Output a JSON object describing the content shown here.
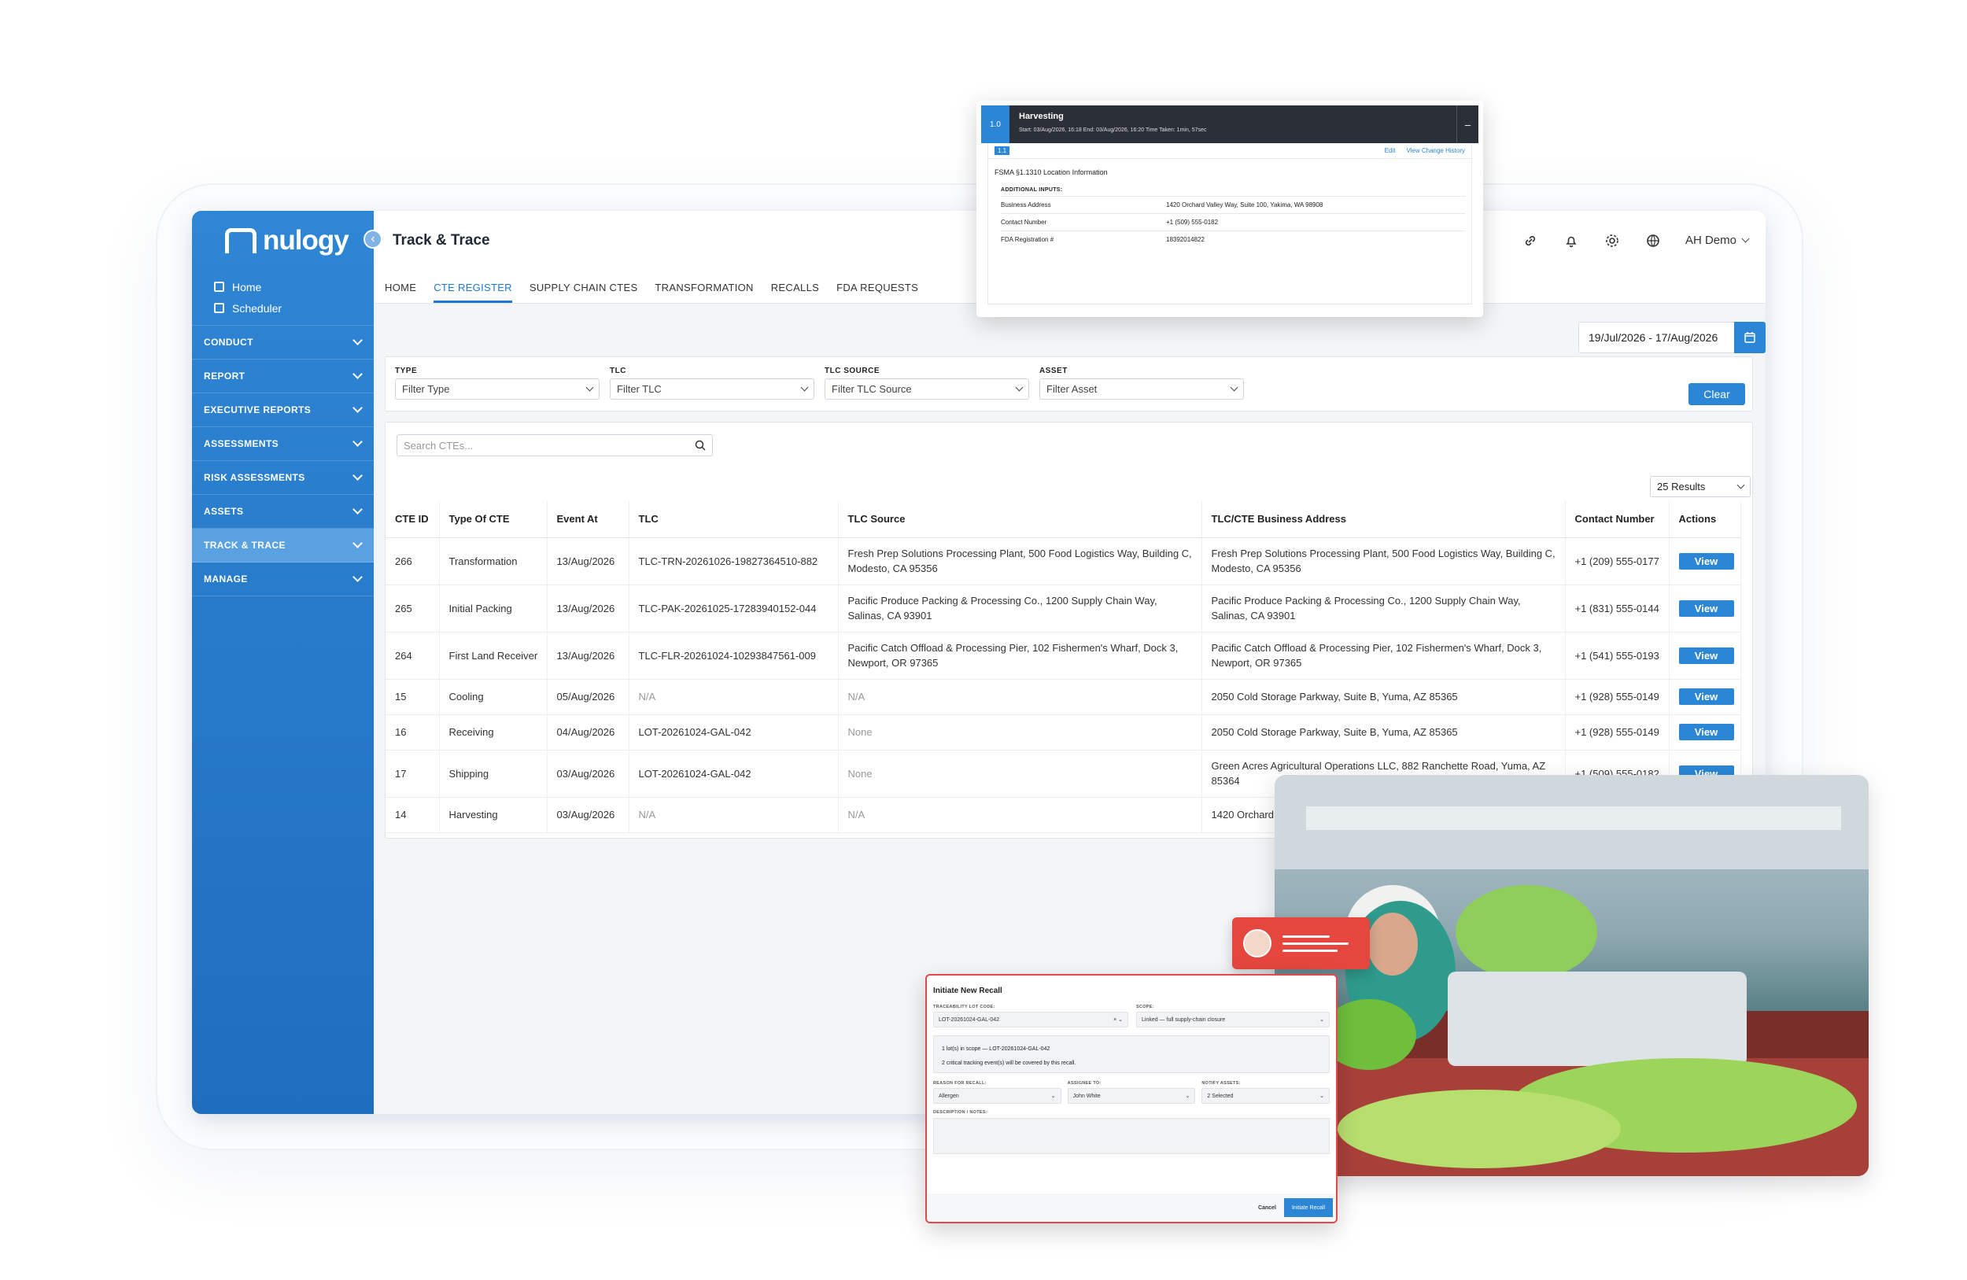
{
  "app": {
    "brand": "nulogy",
    "page_title": "Track & Trace",
    "user": "AH Demo",
    "date_range": "19/Jul/2026 - 17/Aug/2026",
    "clear_label": "Clear",
    "search_placeholder": "Search CTEs...",
    "results_label": "25 Results",
    "view_label": "View"
  },
  "sidebar": {
    "links": [
      {
        "label": "Home",
        "icon": "home-icon"
      },
      {
        "label": "Scheduler",
        "icon": "calendar-icon"
      }
    ],
    "sections": [
      {
        "label": "CONDUCT"
      },
      {
        "label": "REPORT"
      },
      {
        "label": "EXECUTIVE REPORTS"
      },
      {
        "label": "ASSESSMENTS"
      },
      {
        "label": "RISK ASSESSMENTS"
      },
      {
        "label": "ASSETS"
      },
      {
        "label": "TRACK & TRACE"
      },
      {
        "label": "MANAGE"
      }
    ]
  },
  "tabs": [
    "HOME",
    "CTE REGISTER",
    "SUPPLY CHAIN CTES",
    "TRANSFORMATION",
    "RECALLS",
    "FDA REQUESTS"
  ],
  "filters": [
    {
      "label": "TYPE",
      "placeholder": "Filter Type"
    },
    {
      "label": "TLC",
      "placeholder": "Filter TLC"
    },
    {
      "label": "TLC SOURCE",
      "placeholder": "Filter TLC Source"
    },
    {
      "label": "ASSET",
      "placeholder": "Filter Asset"
    }
  ],
  "table": {
    "headers": [
      "CTE ID",
      "Type Of CTE",
      "Event At",
      "TLC",
      "TLC Source",
      "TLC/CTE Business Address",
      "Contact Number",
      "Actions"
    ],
    "rows": [
      [
        "266",
        "Transformation",
        "13/Aug/2026",
        "TLC-TRN-20261026-19827364510-882",
        "Fresh Prep Solutions Processing Plant, 500 Food Logistics Way, Building C, Modesto, CA 95356",
        "Fresh Prep Solutions Processing Plant, 500 Food Logistics Way, Building C, Modesto, CA 95356",
        "+1 (209) 555-0177"
      ],
      [
        "265",
        "Initial Packing",
        "13/Aug/2026",
        "TLC-PAK-20261025-17283940152-044",
        "Pacific Produce Packing & Processing Co., 1200 Supply Chain Way, Salinas, CA 93901",
        "Pacific Produce Packing & Processing Co., 1200 Supply Chain Way, Salinas, CA 93901",
        "+1 (831) 555-0144"
      ],
      [
        "264",
        "First Land Receiver",
        "13/Aug/2026",
        "TLC-FLR-20261024-10293847561-009",
        "Pacific Catch Offload & Processing Pier, 102 Fishermen's Wharf, Dock 3, Newport, OR 97365",
        "Pacific Catch Offload & Processing Pier, 102 Fishermen's Wharf, Dock 3, Newport, OR 97365",
        "+1 (541) 555-0193"
      ],
      [
        "15",
        "Cooling",
        "05/Aug/2026",
        "N/A",
        "N/A",
        "2050 Cold Storage Parkway, Suite B, Yuma, AZ 85365",
        "+1 (928) 555-0149"
      ],
      [
        "16",
        "Receiving",
        "04/Aug/2026",
        "LOT-20261024-GAL-042",
        "None",
        "2050 Cold Storage Parkway, Suite B, Yuma, AZ 85365",
        "+1 (928) 555-0149"
      ],
      [
        "17",
        "Shipping",
        "03/Aug/2026",
        "LOT-20261024-GAL-042",
        "None",
        "Green Acres Agricultural Operations LLC, 882 Ranchette Road, Yuma, AZ 85364",
        "+1 (509) 555-0182"
      ],
      [
        "14",
        "Harvesting",
        "03/Aug/2026",
        "N/A",
        "N/A",
        "1420 Orchard",
        ""
      ]
    ]
  },
  "harvest_popup": {
    "step": "1.0",
    "title": "Harvesting",
    "subtitle": "Start: 03/Aug/2026, 16:18   End: 03/Aug/2026, 16:20   Time Taken: 1min, 57sec",
    "minimize": "–",
    "sub_step": "1.1",
    "edit_label": "Edit",
    "history_label": "View Change History",
    "heading": "FSMA §1.1310 Location Information",
    "additional_label": "ADDITIONAL INPUTS:",
    "fields": [
      {
        "label": "Business Address",
        "value": "1420 Orchard Valley Way, Suite 100, Yakima, WA 98908"
      },
      {
        "label": "Contact Number",
        "value": "+1 (509) 555-0182"
      },
      {
        "label": "FDA Registration #",
        "value": "18392014822"
      }
    ]
  },
  "recall_popup": {
    "title": "Initiate New Recall",
    "lot_label": "TRACEABILITY LOT CODE:",
    "lot_value": "LOT-20261024-GAL-042",
    "scope_label": "SCOPE:",
    "scope_value": "Linked — full supply-chain closure",
    "info_line1": "1 lot(s) in scope — LOT-20261024-GAL-042",
    "info_line2": "2 critical tracking event(s) will be covered by this recall.",
    "reason_label": "REASON FOR RECALL:",
    "reason_value": "Allergen",
    "assignee_label": "ASSIGNEE TO:",
    "assignee_value": "John White",
    "notify_label": "NOTIFY ASSETS:",
    "notify_value": "2 Selected",
    "desc_label": "DESCRIPTION / NOTES:",
    "cancel_label": "Cancel",
    "submit_label": "Initiate Recall"
  },
  "colors": {
    "primary": "#2b86d6",
    "sidebar": "#1f6dbf",
    "alert": "#e5473f"
  }
}
